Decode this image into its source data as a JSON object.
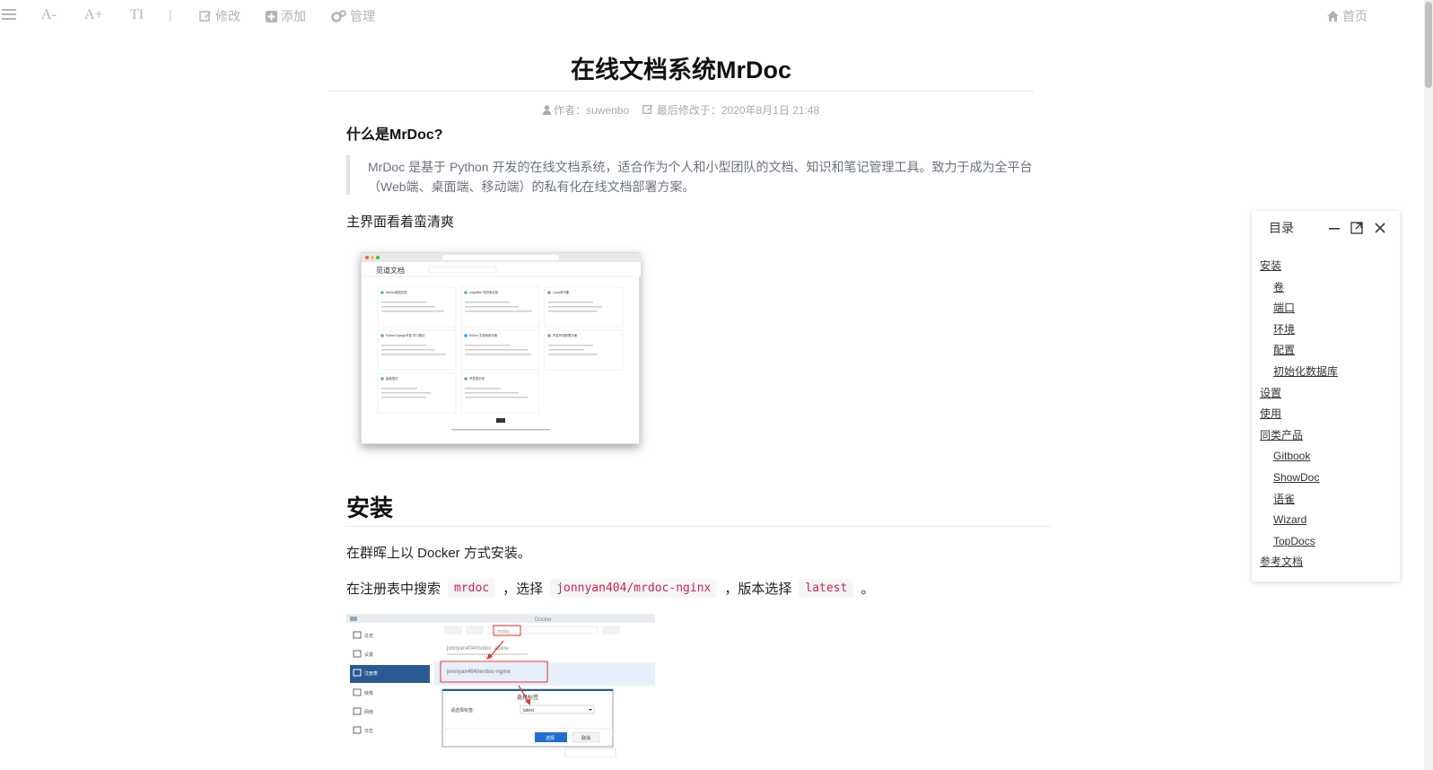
{
  "toolbar": {
    "menu_icon": "menu-icon",
    "font_decrease": "A-",
    "font_increase": "A+",
    "font_style": "TI",
    "separator": "|",
    "edit_label": "修改",
    "add_label": "添加",
    "manage_label": "管理",
    "home_label": "首页"
  },
  "document": {
    "title": "在线文档系统MrDoc",
    "author": "作者：suwenbo",
    "modified": "最后修改于：2020年8月1日 21:48",
    "section1_heading": "什么是MrDoc?",
    "intro_quote": "MrDoc 是基于 Python 开发的在线文档系统，适合作为个人和小型团队的文档、知识和笔记管理工具。致力于成为全平台（Web端、桌面端、移动端）的私有化在线文档部署方案。",
    "main_ui_text": "主界面看着蛮清爽",
    "install_heading": "安装",
    "install_text": "在群晖上以 Docker 方式安装。",
    "registry_text": {
      "part1": "在注册表中搜索",
      "code1": "mrdoc",
      "part2": "，选择",
      "code2": "jonnyan404/mrdoc-nginx",
      "part3": "，版本选择",
      "code3": "latest",
      "part4": "。"
    }
  },
  "screenshot1": {
    "logo": "觅道文档",
    "cards": [
      "MrDoc使用文档",
      "onlyoffice 知识库文档",
      "Linux命令集",
      "Python Django开发 学习笔记",
      "MrDoc 文档系统手册",
      "开发环境配置手册",
      "运维笔记",
      "开发笔记本"
    ]
  },
  "screenshot2": {
    "app_title": "Docker",
    "sidebar": [
      "总览",
      "设置",
      "注册表",
      "映像",
      "网络",
      "日志"
    ],
    "search_value": "mrdoc",
    "result1": "jonnyan404/mrdoc: alpine",
    "result2": "jonnyan404/mrdoc-nginx",
    "dialog_title": "选择标签",
    "dialog_label": "请选择标签:",
    "dialog_value": "latest",
    "select_btn": "选择",
    "cancel_btn": "取消"
  },
  "toc": {
    "title": "目录",
    "items": [
      {
        "label": "安装",
        "level": 1
      },
      {
        "label": "卷",
        "level": 2
      },
      {
        "label": "端口",
        "level": 2
      },
      {
        "label": "环境",
        "level": 2
      },
      {
        "label": "配置",
        "level": 2
      },
      {
        "label": "初始化数据库",
        "level": 2
      },
      {
        "label": "设置",
        "level": 1
      },
      {
        "label": "使用",
        "level": 1
      },
      {
        "label": "同类产品",
        "level": 1
      },
      {
        "label": "Gitbook",
        "level": 2
      },
      {
        "label": "ShowDoc",
        "level": 2
      },
      {
        "label": "语雀",
        "level": 2
      },
      {
        "label": "Wizard",
        "level": 2
      },
      {
        "label": "TopDocs",
        "level": 2
      },
      {
        "label": "参考文档",
        "level": 1
      }
    ]
  },
  "colors": {
    "toolbar_text": "#b3b3b3",
    "code_text": "#c7254e",
    "code_bg": "#f6f6f6",
    "quote_border": "#dfe2e5",
    "link_text": "#333333"
  }
}
